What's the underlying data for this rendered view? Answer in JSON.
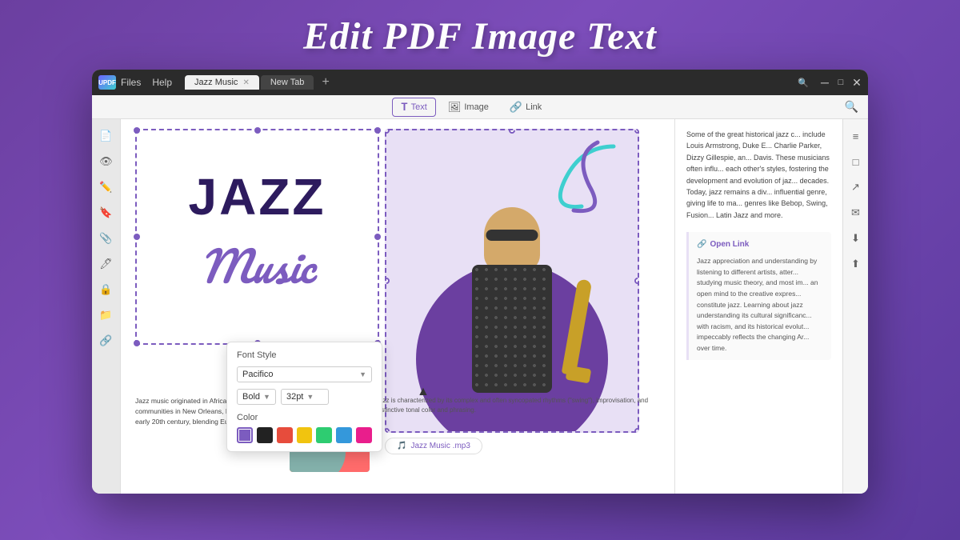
{
  "page": {
    "title": "Edit PDF Image Text",
    "app_name": "UPDF"
  },
  "titlebar": {
    "logo_text": "UPDF",
    "menu_items": [
      "Files",
      "Help"
    ],
    "tabs": [
      {
        "label": "Jazz Music",
        "active": true
      },
      {
        "label": "New Tab",
        "active": false
      }
    ],
    "tab_new_label": "+",
    "controls": [
      "─",
      "□",
      "✕"
    ]
  },
  "toolbar": {
    "buttons": [
      {
        "label": "Text",
        "icon": "T",
        "active": true
      },
      {
        "label": "Image",
        "icon": "🖼",
        "active": false
      },
      {
        "label": "Link",
        "icon": "🔗",
        "active": false
      }
    ],
    "search_icon": "🔍"
  },
  "sidebar_left": {
    "icons": [
      "📄",
      "👁",
      "✏️",
      "🔖",
      "📎",
      "🖊",
      "🔒",
      "📁",
      "🔗"
    ]
  },
  "text_box": {
    "title_line1": "JAZZ",
    "title_line2": "Music"
  },
  "font_popup": {
    "section_label": "Font Style",
    "font_name": "Pacifico",
    "font_style": "Bold",
    "font_size": "32pt",
    "color_label": "Color",
    "colors": [
      {
        "hex": "#7c5cbf",
        "active": true
      },
      {
        "hex": "#222222",
        "active": false
      },
      {
        "hex": "#e74c3c",
        "active": false
      },
      {
        "hex": "#f1c40f",
        "active": false
      },
      {
        "hex": "#2ecc71",
        "active": false
      },
      {
        "hex": "#3498db",
        "active": false
      },
      {
        "hex": "#e91e8c",
        "active": false
      }
    ]
  },
  "bottom_text": {
    "main": "Jazz music originated in African American communities in New Orleans, Louisiana in the early 20th century, blending European and rag...",
    "secondary": "Jazz is characterized by its complex and often syncopated rhythms (\"swing\"), improvisation, and distinctive tonal color and phrasing."
  },
  "image_link": {
    "label": "Jazz Music .mp3",
    "icon": "🎵"
  },
  "right_panel": {
    "text": "Some of the great historical jazz c... include Louis Armstrong, Duke E... Charlie Parker, Dizzy Gillespie, an... Davis. These musicians often influ... each other's styles, fostering the development and evolution of jaz... decades. Today, jazz remains a div... influential genre, giving life to ma... genres like Bebop, Swing, Fusion... Latin Jazz and more.",
    "open_link_title": "Open Link",
    "open_link_text": "Jazz appreciation and understanding by listening to different artists, atter... studying music theory, and most im... an open mind to the creative expres... constitute jazz. Learning about jazz understanding its cultural significanc... with racism, and its historical evolut... impeccably reflects the changing Ar... over time."
  },
  "sidebar_right": {
    "icons": [
      "≡",
      "□",
      "↗",
      "✉",
      "⬇",
      "⬆"
    ]
  }
}
